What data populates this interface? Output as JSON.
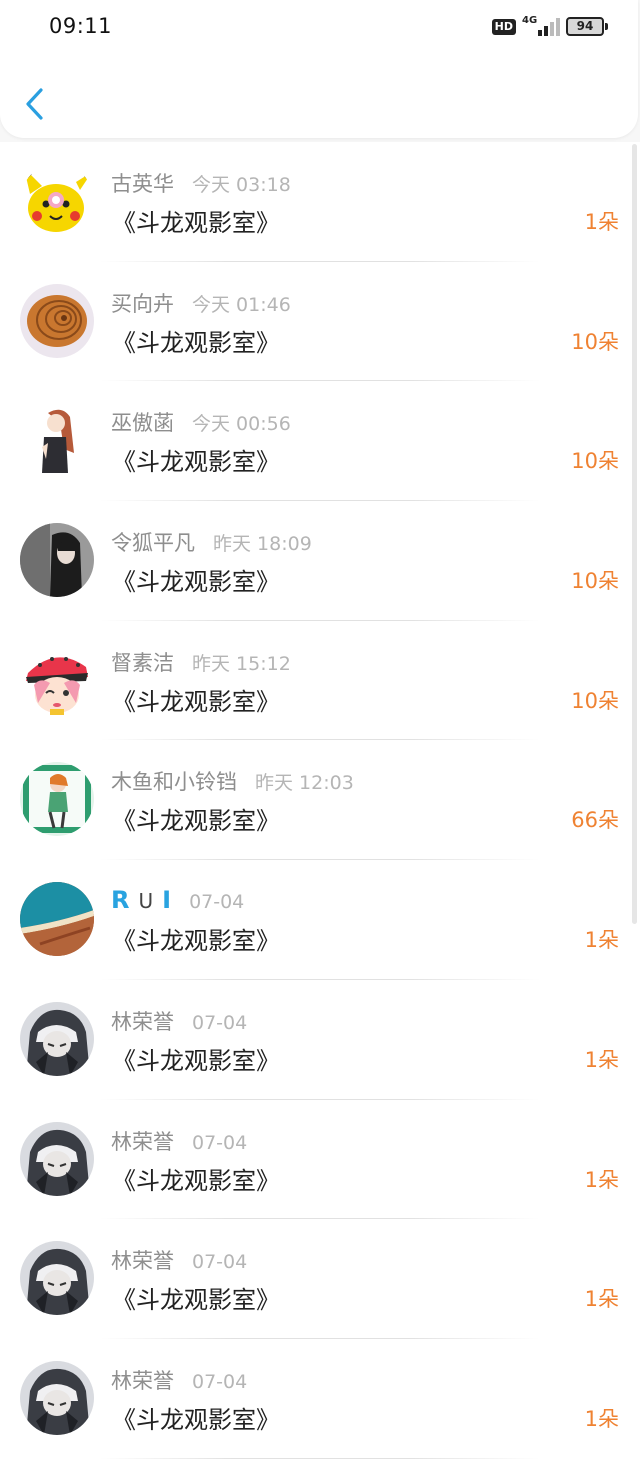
{
  "status_bar": {
    "time": "09:11",
    "hd": "HD",
    "network": "4G",
    "battery": "94"
  },
  "nav": {
    "back_icon": "chevron-left-icon"
  },
  "colors": {
    "accent": "#2a9fe0",
    "amount": "#ef8232",
    "name": "#8e8e8e",
    "title": "#222222"
  },
  "items": [
    {
      "name": "古英华",
      "time": "今天 03:18",
      "title": "《斗龙观影室》",
      "amount": "1朵",
      "avatar": "pikachu-avatar"
    },
    {
      "name": "买向卉",
      "time": "今天 01:46",
      "title": "《斗龙观影室》",
      "amount": "10朵",
      "avatar": "seashell-avatar"
    },
    {
      "name": "巫傲菡",
      "time": "今天 00:56",
      "title": "《斗龙观影室》",
      "amount": "10朵",
      "avatar": "anime-girl-avatar"
    },
    {
      "name": "令狐平凡",
      "time": "昨天 18:09",
      "title": "《斗龙观影室》",
      "amount": "10朵",
      "avatar": "photo-girl-avatar"
    },
    {
      "name": "督素洁",
      "time": "昨天 15:12",
      "title": "《斗龙观影室》",
      "amount": "10朵",
      "avatar": "cartoon-cap-avatar"
    },
    {
      "name": "木鱼和小铃铛",
      "time": "昨天 12:03",
      "title": "《斗龙观影室》",
      "amount": "66朵",
      "avatar": "green-anime-avatar"
    },
    {
      "name": "",
      "name_letters": [
        "R",
        "U",
        "I"
      ],
      "time": "07-04",
      "title": "《斗龙观影室》",
      "amount": "1朵",
      "avatar": "beach-aerial-avatar"
    },
    {
      "name": "林荣誉",
      "time": "07-04",
      "title": "《斗龙观影室》",
      "amount": "1朵",
      "avatar": "dark-anime-avatar"
    },
    {
      "name": "林荣誉",
      "time": "07-04",
      "title": "《斗龙观影室》",
      "amount": "1朵",
      "avatar": "dark-anime-avatar"
    },
    {
      "name": "林荣誉",
      "time": "07-04",
      "title": "《斗龙观影室》",
      "amount": "1朵",
      "avatar": "dark-anime-avatar"
    },
    {
      "name": "林荣誉",
      "time": "07-04",
      "title": "《斗龙观影室》",
      "amount": "1朵",
      "avatar": "dark-anime-avatar"
    }
  ]
}
